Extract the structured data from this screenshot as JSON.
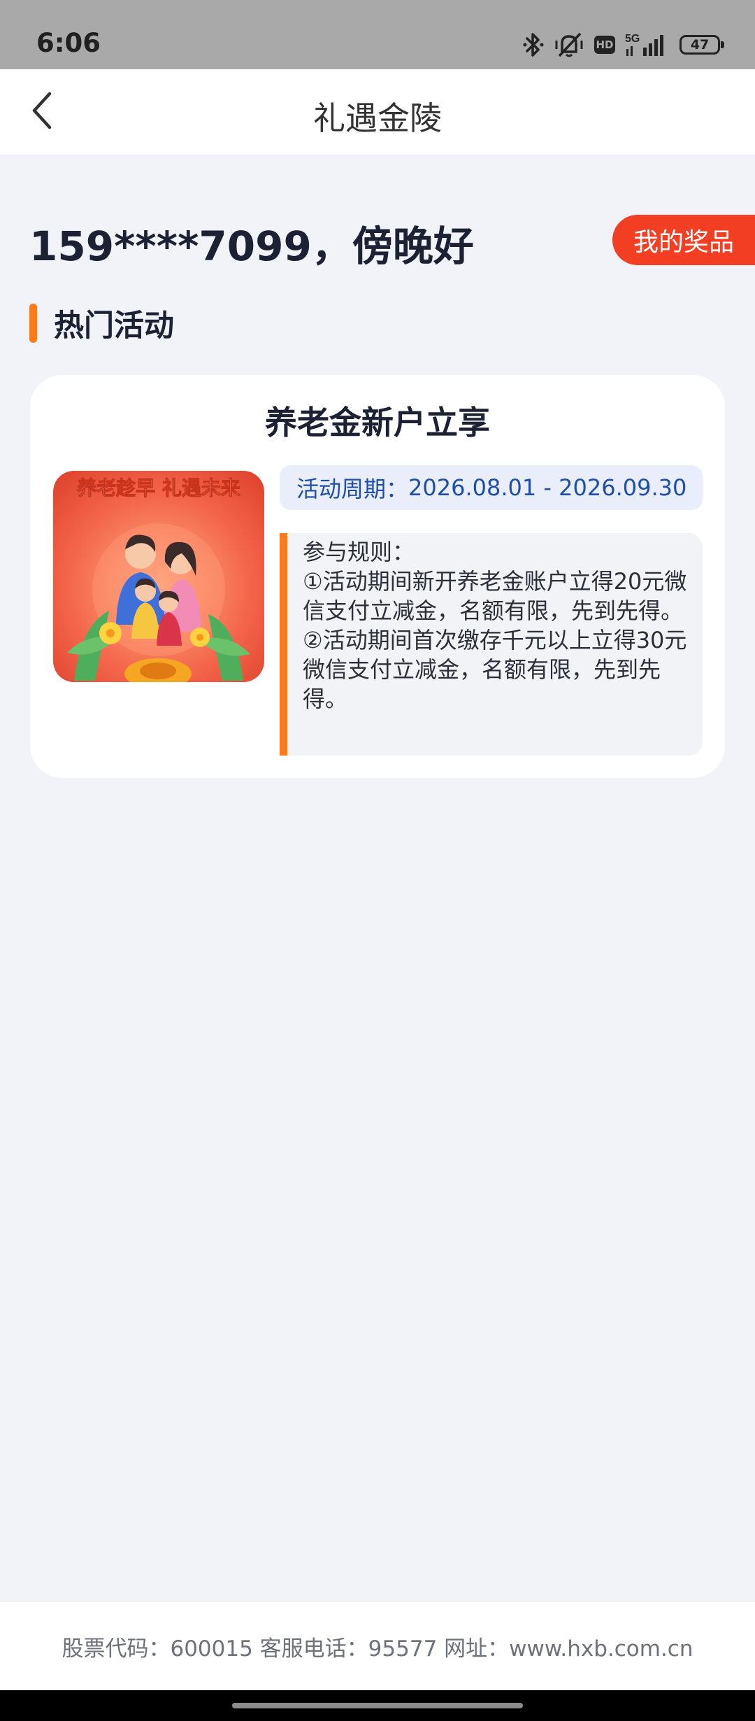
{
  "status_bar": {
    "time": "6:06",
    "network": "5G",
    "hd_badge": "HD",
    "battery": "47",
    "icons": [
      "bluetooth-icon",
      "mute-vibrate-icon",
      "hd-icon",
      "signal-icon",
      "battery-icon"
    ]
  },
  "nav": {
    "title": "礼遇金陵",
    "back_icon": "chevron-left-icon"
  },
  "greeting": "159****7099，傍晚好",
  "prize_button": "我的奖品",
  "section": {
    "title": "热门活动",
    "accent_color": "#ff7a1a"
  },
  "activity": {
    "title": "养老金新户立享",
    "image_banner": "养老趁早 礼遇未来",
    "period_label": "活动周期：",
    "period_value": "2026.08.01 - 2026.09.30",
    "rules_title": "参与规则：",
    "rules": [
      "①活动期间新开养老金账户立得20元微信支付立减金，名额有限，先到先得。",
      "②活动期间首次缴存千元以上立得30元微信支付立减金，名额有限，先到先得。"
    ]
  },
  "footer": {
    "text": "股票代码：600015 客服电话：95577 网址：www.hxb.com.cn"
  },
  "colors": {
    "brand_red": "#f23e23",
    "accent_orange": "#ff7a1a",
    "period_text": "#1e4fa8",
    "page_bg": "#f1f3f9"
  }
}
